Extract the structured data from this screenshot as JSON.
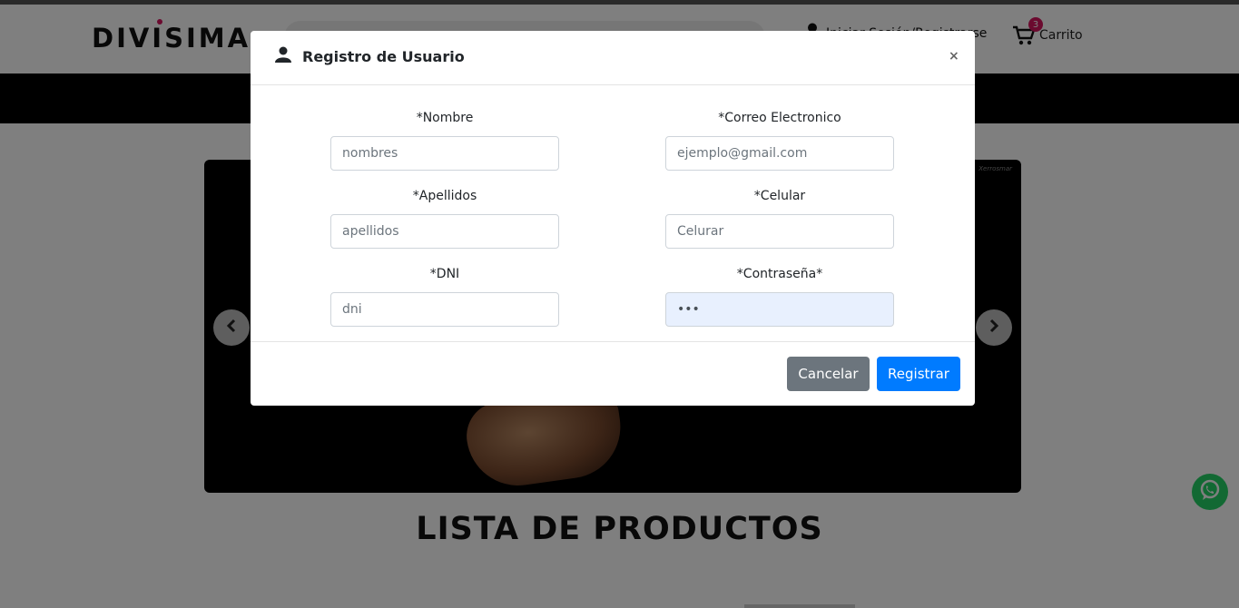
{
  "header": {
    "logo_text": "DIVISIMA",
    "account_text": "Iniciar Sesión/Registrarse",
    "cart_label": "Carrito",
    "cart_count": "3"
  },
  "carousel": {
    "brand_mark": "Xerrosmar"
  },
  "page": {
    "products_title": "LISTA DE PRODUCTOS"
  },
  "modal": {
    "title": "Registro de Usuario",
    "close_symbol": "×",
    "fields": {
      "nombre": {
        "label": "*Nombre",
        "placeholder": "nombres",
        "value": ""
      },
      "correo": {
        "label": "*Correo Electronico",
        "placeholder": "ejemplo@gmail.com",
        "value": ""
      },
      "apellidos": {
        "label": "*Apellidos",
        "placeholder": "apellidos",
        "value": ""
      },
      "celular": {
        "label": "*Celular",
        "placeholder": "Celurar",
        "value": ""
      },
      "dni": {
        "label": "*DNI",
        "placeholder": "dni",
        "value": ""
      },
      "contrasena": {
        "label": "*Contraseña*",
        "placeholder": "",
        "value": "•••"
      }
    },
    "buttons": {
      "cancel": "Cancelar",
      "register": "Registrar"
    }
  },
  "colors": {
    "brand_pink": "#d6155f",
    "primary_blue": "#007bff",
    "secondary_gray": "#6c757d",
    "whatsapp_green": "#25d366"
  },
  "icons": [
    "user-icon",
    "cart-icon",
    "chevron-left-icon",
    "chevron-right-icon",
    "whatsapp-icon",
    "close-icon"
  ]
}
